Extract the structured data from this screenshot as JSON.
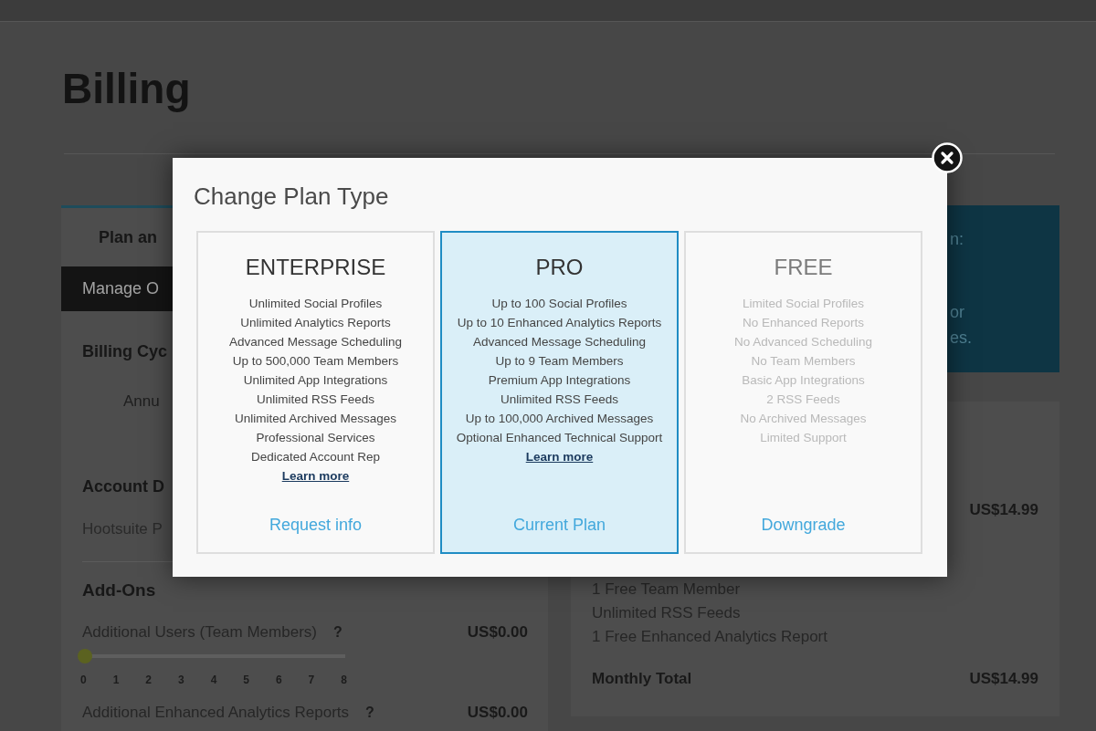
{
  "page": {
    "title": "Billing"
  },
  "billing_panel": {
    "heading": "Plan an",
    "manage_button": "Manage O",
    "cycle": {
      "title": "Billing Cyc",
      "option": "Annu"
    },
    "account": {
      "title": "Account D",
      "plan": "Hootsuite P"
    },
    "addons": {
      "title": "Add-Ons",
      "items": [
        {
          "label": "Additional Users (Team Members)",
          "help": "?",
          "price": "US$0.00",
          "level": 0,
          "ticks": [
            "0",
            "1",
            "2",
            "3",
            "4",
            "5",
            "6",
            "7",
            "8"
          ]
        },
        {
          "label": "Additional Enhanced Analytics Reports",
          "help": "?",
          "price": "US$0.00"
        }
      ]
    }
  },
  "info_banner": {
    "heading": "n:",
    "lines": [
      "or",
      "es."
    ]
  },
  "summary": {
    "plan_price": "US$14.99",
    "features": [
      "1 Free Team Member",
      "Unlimited RSS Feeds",
      "1 Free Enhanced Analytics Report"
    ],
    "total_label": "Monthly Total",
    "total": "US$14.99"
  },
  "modal": {
    "title": "Change Plan Type",
    "plans": [
      {
        "name": "ENTERPRISE",
        "selected": false,
        "greyed": false,
        "features": [
          "Unlimited Social Profiles",
          "Unlimited Analytics Reports",
          "Advanced Message Scheduling",
          "Up to 500,000 Team Members",
          "Unlimited App Integrations",
          "Unlimited RSS Feeds",
          "Unlimited Archived Messages",
          "Professional Services",
          "Dedicated Account Rep"
        ],
        "learn_more": "Learn more",
        "action": "Request info"
      },
      {
        "name": "PRO",
        "selected": true,
        "greyed": false,
        "features": [
          "Up to 100 Social Profiles",
          "Up to 10 Enhanced Analytics Reports",
          "Advanced Message Scheduling",
          "Up to 9 Team Members",
          "Premium App Integrations",
          "Unlimited RSS Feeds",
          "Up to 100,000 Archived Messages",
          "Optional Enhanced Technical Support"
        ],
        "learn_more": "Learn more",
        "action": "Current Plan"
      },
      {
        "name": "FREE",
        "selected": false,
        "greyed": true,
        "features": [
          "Limited Social Profiles",
          "No Enhanced Reports",
          "No Advanced Scheduling",
          "No Team Members",
          "Basic App Integrations",
          "2 RSS Feeds",
          "No Archived Messages",
          "Limited Support"
        ],
        "action": "Downgrade"
      }
    ]
  }
}
